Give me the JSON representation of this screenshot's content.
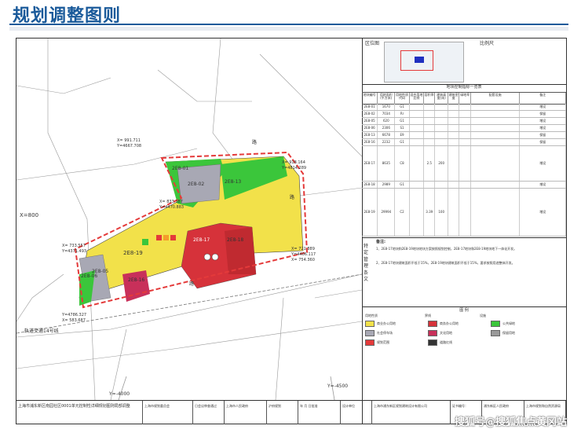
{
  "header": {
    "title": "规划调整图则"
  },
  "map": {
    "x_axis_label": "X=800",
    "y_axis_labels": [
      "Y=-4000",
      "Y=-4500"
    ],
    "coords": [
      "X= 991.711",
      "Y=4667.708",
      "X= 918.164",
      "Y=4814.289",
      "X= 833.187",
      "Y=4470.883",
      "X= 733.557",
      "Y=4371.493",
      "X= 721.889",
      "Y=4406.117",
      "X= 754.360",
      "Y=4786.327",
      "X= 583.687",
      "Y=4392.376"
    ],
    "rail_label": "轨道交通14号线",
    "parcels": [
      "2E8-01",
      "2E8-02",
      "2E8-13",
      "2E8-19",
      "2E8-17",
      "2E8-18",
      "2E8-06",
      "2E8-16",
      "2E8-05"
    ],
    "road_labels": [
      "路",
      "路",
      "路"
    ]
  },
  "side": {
    "location_label": "区位图",
    "scale_label": "比例尺",
    "table_title": "地块控制指标一览表",
    "table_headers": [
      "地块编号",
      "用地面积(平方米)",
      "用地性质代码",
      "混合用地比例",
      "容积率",
      "建筑高度(米)",
      "建筑密度",
      "绿地率",
      "配套设施",
      "备注"
    ],
    "table_rows": [
      [
        "2E8-01",
        "1670",
        "G1",
        "",
        "",
        "",
        "",
        "",
        "",
        "增设"
      ],
      [
        "2E8-02",
        "7034",
        "Rr",
        "",
        "",
        "",
        "",
        "",
        "",
        "保留"
      ],
      [
        "2E8-05",
        "620",
        "G1",
        "",
        "",
        "",
        "",
        "",
        "",
        "增设"
      ],
      [
        "2E8-06",
        "2306",
        "S1",
        "",
        "",
        "",
        "",
        "",
        "",
        "增设"
      ],
      [
        "2E8-13",
        "6678",
        "E9",
        "",
        "",
        "",
        "",
        "",
        "",
        "保留"
      ],
      [
        "2E8-16",
        "2232",
        "G1",
        "",
        "",
        "",
        "",
        "",
        "",
        "保留"
      ],
      [
        "2E8-17",
        "8635",
        "C8",
        "",
        "2.5",
        "200",
        "",
        "",
        "",
        "增设"
      ],
      [
        "2E8-18",
        "2989",
        "G1",
        "",
        "",
        "",
        "",
        "",
        "",
        "增设"
      ],
      [
        "2E8-19",
        "29994",
        "C2",
        "",
        "3.39",
        "100",
        "",
        "",
        "",
        "增设"
      ]
    ],
    "special_label": "特定管理条文",
    "notes_title": "备注:",
    "notes": [
      "1、2E8-17地块和2E8-19地块地块方案按照规划控制，2E8-17地块和2E8-19地块地下一体化开发。",
      "2、2E8-17地块建筑面积不低于15%，2E8-19地块建筑面积不低于15%，要求按照用途整体开发。"
    ],
    "legend_title": "图 例",
    "legend_groups": [
      "用地性质",
      "界线",
      "设施"
    ],
    "legend_items": [
      {
        "label": "商业办公用地",
        "color": "#f2e14a"
      },
      {
        "label": "商务办公用地",
        "color": "#d6323a"
      },
      {
        "label": "公共绿地",
        "color": "#3bc63b"
      },
      {
        "label": "社会停车场",
        "color": "#a8a8b4"
      },
      {
        "label": "文化用地",
        "color": "#c8305a"
      },
      {
        "label": "保留用地",
        "color": "#9a9a9a"
      },
      {
        "label": "规划范围",
        "color": "#e43a3a"
      },
      {
        "label": "道路红线",
        "color": "#333333"
      }
    ]
  },
  "bottom": {
    "project_name": "上海市浦东新区南园社区0001单元控制性详细规划图则局部调整",
    "cells": [
      "上海市规划委员会",
      "日会议审查通过",
      "上海市人民政府",
      "沪府规划",
      "年 月 日批准",
      "设计单位",
      "上海市浦东新区规划建筑设计有限公司",
      "证书编号：",
      "浦东新区人民政府",
      "上海市规划和自然资源局"
    ]
  },
  "watermark": "搜狐号@搜狐焦点黄冈站"
}
